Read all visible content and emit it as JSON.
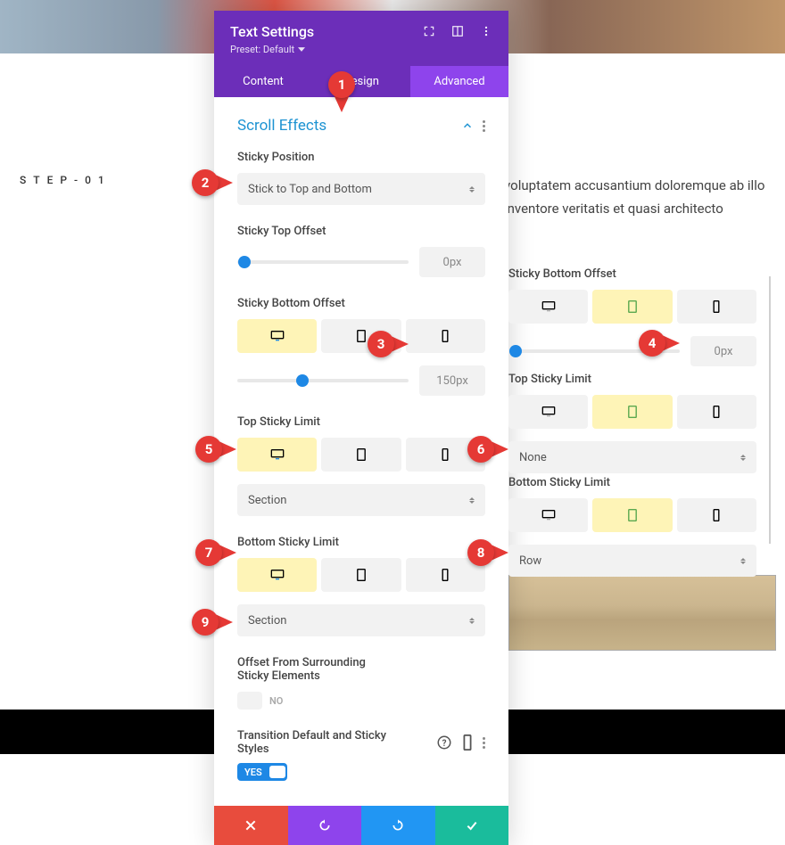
{
  "step_label": "STEP-01",
  "lorem": "voluptatem accusantium doloremque ab illo inventore veritatis et quasi architecto",
  "header": {
    "title": "Text Settings",
    "preset_label": "Preset: Default"
  },
  "tabs": {
    "content": "Content",
    "design": "Design",
    "advanced": "Advanced"
  },
  "section": {
    "title": "Scroll Effects"
  },
  "sticky_position": {
    "label": "Sticky Position",
    "value": "Stick to Top and Bottom"
  },
  "sticky_top_offset": {
    "label": "Sticky Top Offset",
    "value": "0px"
  },
  "sticky_bottom_offset": {
    "label": "Sticky Bottom Offset",
    "value": "150px"
  },
  "top_sticky_limit": {
    "label": "Top Sticky Limit",
    "value": "Section"
  },
  "bottom_sticky_limit": {
    "label": "Bottom Sticky Limit",
    "value": "Section"
  },
  "offset_surrounding": {
    "label": "Offset From Surrounding Sticky Elements",
    "value": "NO"
  },
  "transition_styles": {
    "label": "Transition Default and Sticky Styles",
    "value": "YES"
  },
  "alt": {
    "sticky_bottom_offset": {
      "label": "Sticky Bottom Offset",
      "value": "0px"
    },
    "top_sticky_limit": {
      "label": "Top Sticky Limit",
      "value": "None"
    },
    "bottom_sticky_limit": {
      "label": "Bottom Sticky Limit",
      "value": "Row"
    }
  },
  "callouts": {
    "1": "1",
    "2": "2",
    "3": "3",
    "4": "4",
    "5": "5",
    "6": "6",
    "7": "7",
    "8": "8",
    "9": "9"
  }
}
